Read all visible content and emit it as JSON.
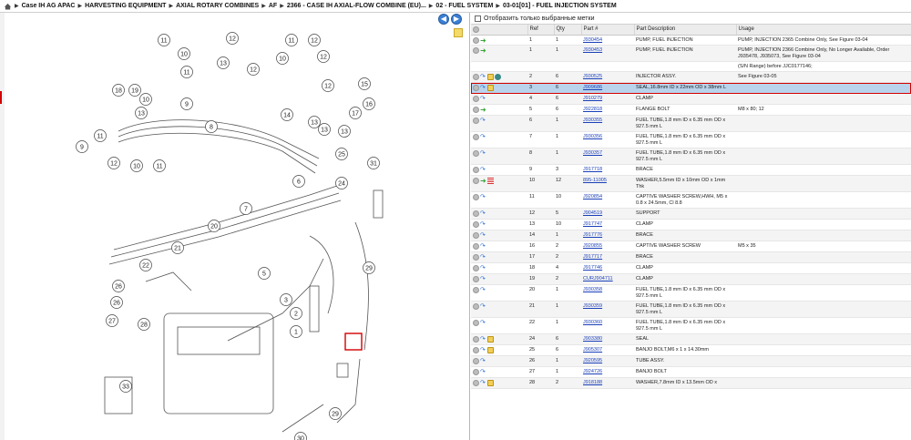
{
  "breadcrumb": [
    "Case IH AG APAC",
    "HARVESTING EQUIPMENT",
    "AXIAL ROTARY COMBINES",
    "AF",
    "2366 - CASE IH AXIAL-FLOW COMBINE (EU)...",
    "02 - FUEL SYSTEM",
    "03-01[01] - FUEL INJECTION SYSTEM"
  ],
  "filter": {
    "label": "Отобразить только выбранные метки"
  },
  "columns": [
    "Ref",
    "Qty",
    "Part #",
    "Part Description",
    "Usage"
  ],
  "icons": {
    "home": "home-icon",
    "back": "arrow-left-icon",
    "forward": "arrow-right-icon",
    "note": "note-icon"
  },
  "rows": [
    {
      "icons": [
        "circle",
        "green"
      ],
      "ref": "1",
      "qty": "1",
      "part": "J930454",
      "desc": "PUMP, FUEL INJECTION",
      "usage": "PUMP, INJECTION 2365 Combine Only, See Figure 03-04"
    },
    {
      "icons": [
        "circle",
        "green"
      ],
      "ref": "1",
      "qty": "1",
      "part": "J930453",
      "desc": "PUMP, FUEL INJECTION",
      "usage": "PUMP, INJECTION 2366 Combine Only, No Longer Available, Order J935478, J935073, See Figure 03-04"
    },
    {
      "icons": [],
      "ref": "",
      "qty": "",
      "part": "",
      "desc": "",
      "usage": "(S/N Range) before JJC0177146;"
    },
    {
      "icons": [
        "circle",
        "blue",
        "note",
        "globe"
      ],
      "ref": "2",
      "qty": "6",
      "part": "J930525",
      "desc": "INJECTOR ASSY.",
      "usage": "See Figure 03-05"
    },
    {
      "icons": [
        "circle",
        "blue",
        "note"
      ],
      "ref": "3",
      "qty": "6",
      "part": "J909686",
      "desc": "SEAL,16.8mm ID x 22mm OD x 38mm L",
      "usage": "",
      "selected": true
    },
    {
      "icons": [
        "circle",
        "blue"
      ],
      "ref": "4",
      "qty": "6",
      "part": "J910279",
      "desc": "CLAMP",
      "usage": ""
    },
    {
      "icons": [
        "circle",
        "green"
      ],
      "ref": "5",
      "qty": "6",
      "part": "J922818",
      "desc": "FLANGE BOLT",
      "usage": "M8 x 80; 12"
    },
    {
      "icons": [
        "circle",
        "blue"
      ],
      "ref": "6",
      "qty": "1",
      "part": "J930355",
      "desc": "FUEL TUBE,1.8 mm ID x 6.35 mm OD x 927.5 mm L",
      "usage": ""
    },
    {
      "icons": [
        "circle",
        "blue"
      ],
      "ref": "7",
      "qty": "1",
      "part": "J930356",
      "desc": "FUEL TUBE,1.8 mm ID x 6.35 mm OD x 927.5 mm L",
      "usage": ""
    },
    {
      "icons": [
        "circle",
        "blue"
      ],
      "ref": "8",
      "qty": "1",
      "part": "J930357",
      "desc": "FUEL TUBE,1.8 mm ID x 6.35 mm OD x 927.5 mm L",
      "usage": ""
    },
    {
      "icons": [
        "circle",
        "blue"
      ],
      "ref": "9",
      "qty": "3",
      "part": "J917718",
      "desc": "BRACE",
      "usage": ""
    },
    {
      "icons": [
        "circle",
        "green",
        "stop"
      ],
      "ref": "10",
      "qty": "12",
      "part": "895-11005",
      "desc": "WASHER,5.5mm ID x 10mm OD x 1mm Thk",
      "usage": ""
    },
    {
      "icons": [
        "circle",
        "blue"
      ],
      "ref": "11",
      "qty": "10",
      "part": "J920854",
      "desc": "CAPTIVE WASHER SCREW,HWH, M5 x 0.8 x 24.5mm, Cl 8.8",
      "usage": ""
    },
    {
      "icons": [
        "circle",
        "blue"
      ],
      "ref": "12",
      "qty": "5",
      "part": "J904519",
      "desc": "SUPPORT",
      "usage": ""
    },
    {
      "icons": [
        "circle",
        "blue"
      ],
      "ref": "13",
      "qty": "10",
      "part": "J917747",
      "desc": "CLAMP",
      "usage": ""
    },
    {
      "icons": [
        "circle",
        "blue"
      ],
      "ref": "14",
      "qty": "1",
      "part": "J917776",
      "desc": "BRACE",
      "usage": ""
    },
    {
      "icons": [
        "circle",
        "blue"
      ],
      "ref": "16",
      "qty": "2",
      "part": "J920855",
      "desc": "CAPTIVE WASHER SCREW",
      "usage": "M5 x 35"
    },
    {
      "icons": [
        "circle",
        "blue"
      ],
      "ref": "17",
      "qty": "2",
      "part": "J917717",
      "desc": "BRACE",
      "usage": ""
    },
    {
      "icons": [
        "circle",
        "blue"
      ],
      "ref": "18",
      "qty": "4",
      "part": "J917746",
      "desc": "CLAMP",
      "usage": ""
    },
    {
      "icons": [
        "circle",
        "blue"
      ],
      "ref": "19",
      "qty": "2",
      "part": "CURJ904711",
      "desc": "CLAMP",
      "usage": ""
    },
    {
      "icons": [
        "circle",
        "blue"
      ],
      "ref": "20",
      "qty": "1",
      "part": "J930358",
      "desc": "FUEL TUBE,1.8 mm ID x 6.35 mm OD x 927.5 mm L",
      "usage": ""
    },
    {
      "icons": [
        "circle",
        "blue"
      ],
      "ref": "21",
      "qty": "1",
      "part": "J930359",
      "desc": "FUEL TUBE,1.8 mm ID x 6.35 mm OD x 927.5 mm L",
      "usage": ""
    },
    {
      "icons": [
        "circle",
        "blue"
      ],
      "ref": "22",
      "qty": "1",
      "part": "J930360",
      "desc": "FUEL TUBE,1.8 mm ID x 6.35 mm OD x 927.5 mm L",
      "usage": ""
    },
    {
      "icons": [
        "circle",
        "blue",
        "note"
      ],
      "ref": "24",
      "qty": "6",
      "part": "J903380",
      "desc": "SEAL",
      "usage": ""
    },
    {
      "icons": [
        "circle",
        "blue",
        "note"
      ],
      "ref": "25",
      "qty": "6",
      "part": "J905307",
      "desc": "BANJO BOLT,M6 x 1 x 14.30mm",
      "usage": ""
    },
    {
      "icons": [
        "circle",
        "blue"
      ],
      "ref": "26",
      "qty": "1",
      "part": "J920595",
      "desc": "TUBE ASSY.",
      "usage": ""
    },
    {
      "icons": [
        "circle",
        "blue"
      ],
      "ref": "27",
      "qty": "1",
      "part": "J924726",
      "desc": "BANJO BOLT",
      "usage": ""
    },
    {
      "icons": [
        "circle",
        "blue",
        "note"
      ],
      "ref": "28",
      "qty": "2",
      "part": "J918188",
      "desc": "WASHER,7.8mm ID x 13.5mm OD x",
      "usage": ""
    }
  ],
  "diagram": {
    "callouts": [
      "11",
      "10",
      "12",
      "13",
      "11",
      "12",
      "10",
      "11",
      "12",
      "12",
      "15",
      "16",
      "18",
      "19",
      "10",
      "9",
      "11",
      "13",
      "12",
      "14",
      "12",
      "13",
      "10",
      "11",
      "8",
      "25",
      "31",
      "6",
      "24",
      "7",
      "26",
      "20",
      "21",
      "22",
      "26",
      "27",
      "28",
      "5",
      "3",
      "2",
      "1",
      "29",
      "33",
      "30",
      "9",
      "13",
      "13",
      "17",
      "29"
    ]
  }
}
